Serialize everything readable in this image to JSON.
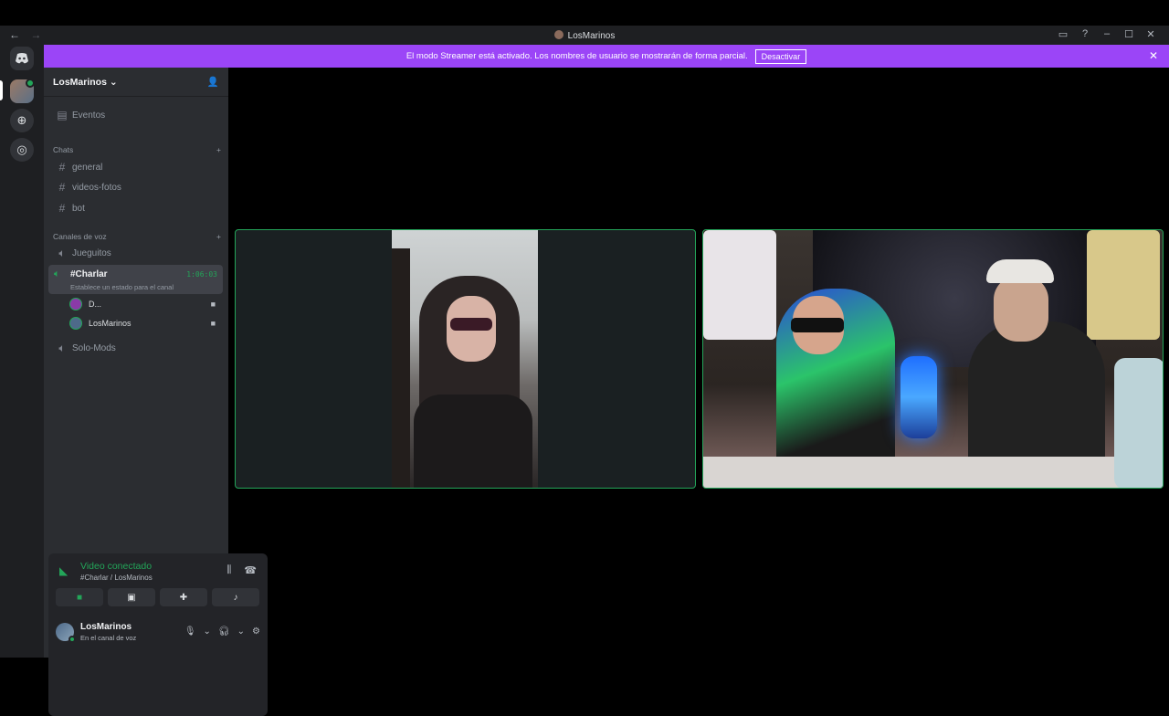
{
  "window": {
    "title": "LosMarinos",
    "nav_back": "←",
    "nav_forward": "→",
    "inbox_icon": "inbox-icon",
    "help_icon": "help-icon",
    "minimize": "–",
    "maximize": "☐",
    "close": "✕"
  },
  "banner": {
    "text": "El modo Streamer está activado. Los nombres de usuario se mostrarán de forma parcial.",
    "button": "Desactivar",
    "close": "✕"
  },
  "server": {
    "name": "LosMarinos",
    "chevron": "⌄",
    "invite_icon": "add-person-icon"
  },
  "sidebar": {
    "events": "Eventos",
    "chats_category": "Chats",
    "text_channels": [
      "general",
      "videos-fotos",
      "bot"
    ],
    "voice_category": "Canales de voz",
    "voice_channels": {
      "first": "Jueguitos",
      "active": "#Charlar",
      "active_timer": "1:06:03",
      "active_status": "Establece un estado para el canal",
      "last": "Solo-Mods"
    },
    "members": [
      "D...",
      "LosMarinos"
    ],
    "add": "+"
  },
  "voice_panel": {
    "title": "Video conectado",
    "subtitle": "#Charlar / LosMarinos"
  },
  "user": {
    "name": "LosMarinos",
    "status": "En el canal de voz"
  },
  "colors": {
    "accent_green": "#23a559",
    "streamer_banner": "#9b45f7",
    "sidebar": "#2b2d31",
    "rail": "#1e1f22"
  }
}
